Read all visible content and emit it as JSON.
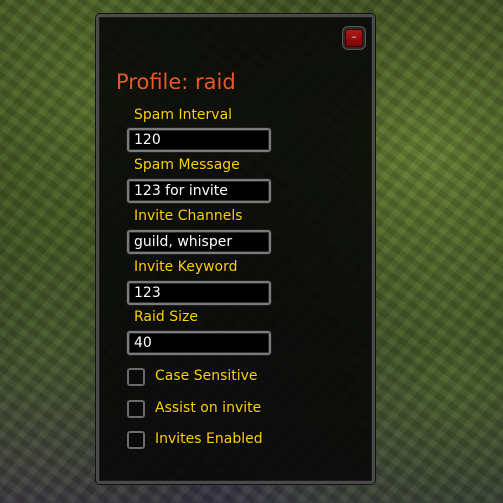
{
  "window": {
    "title": "Profile: raid",
    "close_label": "–"
  },
  "fields": [
    {
      "label": "Spam Interval",
      "value": "120"
    },
    {
      "label": "Spam Message",
      "value": "123 for invite"
    },
    {
      "label": "Invite Channels",
      "value": "guild, whisper"
    },
    {
      "label": "Invite Keyword",
      "value": "123"
    },
    {
      "label": "Raid Size",
      "value": "40"
    }
  ],
  "checkboxes": [
    {
      "label": "Case Sensitive",
      "checked": false
    },
    {
      "label": "Assist on invite",
      "checked": false
    },
    {
      "label": "Invites Enabled",
      "checked": false
    }
  ],
  "colors": {
    "title": "#e8582a",
    "label": "#ffd100",
    "value": "#ffffff",
    "close_button": "#a01010"
  }
}
